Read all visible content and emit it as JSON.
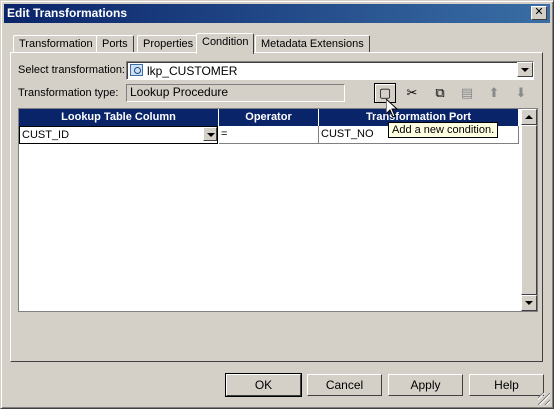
{
  "window": {
    "title": "Edit Transformations",
    "close_glyph": "✕"
  },
  "tabs": [
    {
      "label": "Transformation",
      "active": false
    },
    {
      "label": "Ports",
      "active": false
    },
    {
      "label": "Properties",
      "active": false
    },
    {
      "label": "Condition",
      "active": true
    },
    {
      "label": "Metadata Extensions",
      "active": false
    }
  ],
  "select_transformation": {
    "label": "Select transformation:",
    "value": "lkp_CUSTOMER",
    "icon": "lookup-transformation-icon"
  },
  "transformation_type": {
    "label": "Transformation type:",
    "value": "Lookup Procedure"
  },
  "toolbar": [
    {
      "name": "add-condition",
      "icon": "new-document-icon",
      "glyph": "▢",
      "enabled": true
    },
    {
      "name": "cut",
      "icon": "scissors-icon",
      "glyph": "✂",
      "enabled": true
    },
    {
      "name": "copy",
      "icon": "copy-icon",
      "glyph": "⧉",
      "enabled": true
    },
    {
      "name": "paste",
      "icon": "paste-icon",
      "glyph": "▤",
      "enabled": false
    },
    {
      "name": "move-up",
      "icon": "arrow-up-icon",
      "glyph": "⬆",
      "enabled": false
    },
    {
      "name": "move-down",
      "icon": "arrow-down-icon",
      "glyph": "⬇",
      "enabled": false
    }
  ],
  "tooltip": "Add a new condition.",
  "grid": {
    "columns": [
      "Lookup Table Column",
      "Operator",
      "Transformation Port"
    ],
    "rows": [
      {
        "lookup_column": "CUST_ID",
        "operator": "=",
        "port": "CUST_NO"
      }
    ]
  },
  "buttons": {
    "ok": "OK",
    "cancel": "Cancel",
    "apply": "Apply",
    "help": "Help"
  },
  "colors": {
    "title_bar": "#0a246a",
    "grid_header": "#0a246a",
    "dialog_bg": "#d4d0c8",
    "tooltip_bg": "#ffffe1"
  }
}
